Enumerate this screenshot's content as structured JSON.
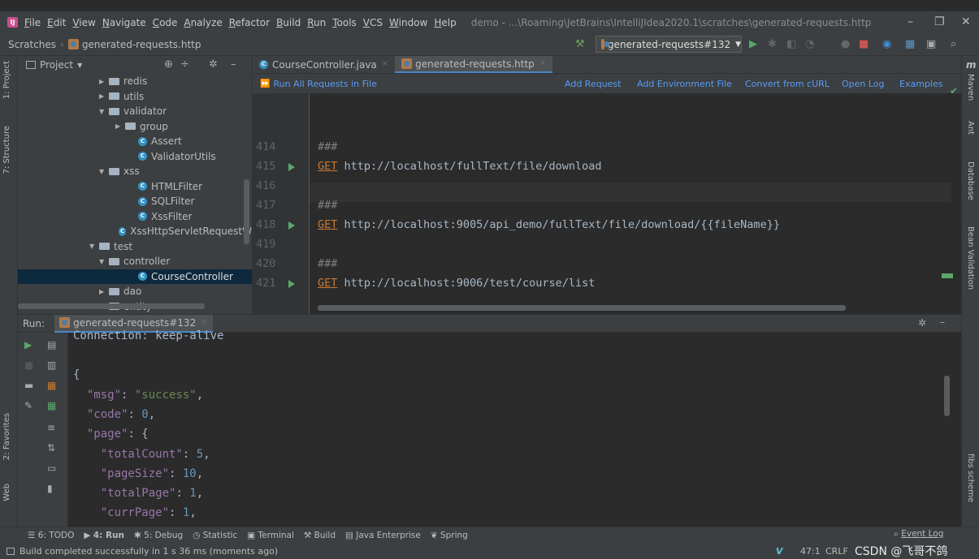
{
  "menubar": {
    "items": [
      "File",
      "Edit",
      "View",
      "Navigate",
      "Code",
      "Analyze",
      "Refactor",
      "Build",
      "Run",
      "Tools",
      "VCS",
      "Window",
      "Help"
    ],
    "title": "demo - ...\\Roaming\\JetBrains\\IntelliJIdea2020.1\\scratches\\generated-requests.http"
  },
  "navbar": {
    "root": "Scratches",
    "file": "generated-requests.http",
    "run_config": "generated-requests#132"
  },
  "project": {
    "title": "Project",
    "tree": [
      {
        "label": "redis",
        "kind": "folder",
        "depth": 4,
        "arrow": "▶"
      },
      {
        "label": "utils",
        "kind": "folder",
        "depth": 4,
        "arrow": "▶"
      },
      {
        "label": "validator",
        "kind": "folder",
        "depth": 4,
        "arrow": "▼"
      },
      {
        "label": "group",
        "kind": "folder",
        "depth": 5,
        "arrow": "▶"
      },
      {
        "label": "Assert",
        "kind": "class",
        "depth": 6,
        "arrow": ""
      },
      {
        "label": "ValidatorUtils",
        "kind": "class",
        "depth": 6,
        "arrow": ""
      },
      {
        "label": "xss",
        "kind": "folder",
        "depth": 4,
        "arrow": "▼"
      },
      {
        "label": "HTMLFilter",
        "kind": "class",
        "depth": 6,
        "arrow": ""
      },
      {
        "label": "SQLFilter",
        "kind": "class",
        "depth": 6,
        "arrow": ""
      },
      {
        "label": "XssFilter",
        "kind": "class",
        "depth": 6,
        "arrow": ""
      },
      {
        "label": "XssHttpServletRequestW",
        "kind": "class",
        "depth": 6,
        "arrow": ""
      },
      {
        "label": "test",
        "kind": "folder",
        "depth": 3,
        "arrow": "▼"
      },
      {
        "label": "controller",
        "kind": "folder",
        "depth": 4,
        "arrow": "▼"
      },
      {
        "label": "CourseController",
        "kind": "class",
        "depth": 6,
        "arrow": "",
        "selected": true
      },
      {
        "label": "dao",
        "kind": "folder",
        "depth": 4,
        "arrow": "▶"
      },
      {
        "label": "entity",
        "kind": "folder",
        "depth": 4,
        "arrow": "▶"
      }
    ]
  },
  "editor": {
    "tabs": [
      "CourseController.java",
      "generated-requests.http"
    ],
    "toolbar": {
      "run_all": "Run All Requests in File",
      "links": [
        "Add Request",
        "Add Environment File",
        "Convert from cURL",
        "Open Log",
        "Examples"
      ]
    },
    "lines": [
      {
        "num": "414",
        "method": "",
        "text": "###",
        "run": false
      },
      {
        "num": "415",
        "method": "GET",
        "text": " http://localhost/fullText/file/download",
        "run": true
      },
      {
        "num": "416",
        "method": "",
        "text": "",
        "run": false
      },
      {
        "num": "417",
        "method": "",
        "text": "###",
        "run": false
      },
      {
        "num": "418",
        "method": "GET",
        "text": " http://localhost:9005/api_demo/fullText/file/download/{{fileName}}",
        "run": true
      },
      {
        "num": "419",
        "method": "",
        "text": "",
        "run": false
      },
      {
        "num": "420",
        "method": "",
        "text": "###",
        "run": false
      },
      {
        "num": "421",
        "method": "GET",
        "text": " http://localhost:9006/test/course/list",
        "run": true
      }
    ]
  },
  "run_panel": {
    "label": "Run:",
    "tab": "generated-requests#132",
    "console": {
      "conn": "Connection: keep-alive",
      "open": "{",
      "msg_key": "\"msg\"",
      "msg_val": "\"success\"",
      "code_key": "\"code\"",
      "code_val": "0",
      "page_key": "\"page\"",
      "tc_key": "\"totalCount\"",
      "tc_val": "5",
      "ps_key": "\"pageSize\"",
      "ps_val": "10",
      "tp_key": "\"totalPage\"",
      "tp_val": "1",
      "cp_key": "\"currPage\"",
      "cp_val": "1"
    }
  },
  "left_tool": [
    "1: Project",
    "7: Structure",
    "2: Favorites",
    "Web"
  ],
  "right_tool": [
    "Maven",
    "Ant",
    "Database",
    "Bean Validation",
    "fibs scheme"
  ],
  "bottom_tabs": [
    "6: TODO",
    "4: Run",
    "5: Debug",
    "Statistic",
    "Terminal",
    "Build",
    "Java Enterprise",
    "Spring"
  ],
  "event_log": "Event Log",
  "status": {
    "message": "Build completed successfully in 1 s 36 ms (moments ago)",
    "position": "47:1",
    "line_sep": "CRLF",
    "watermark": "CSDN @飞哥不鸽"
  }
}
